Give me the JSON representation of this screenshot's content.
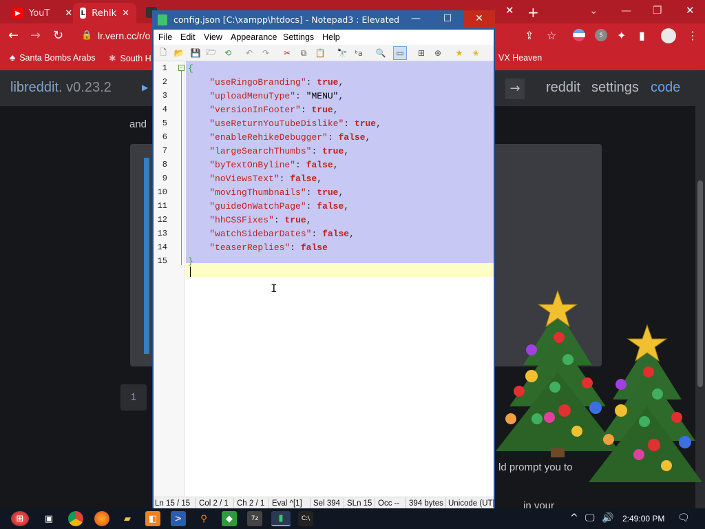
{
  "browser": {
    "tabs": [
      {
        "label": "YouT",
        "icon": "youtube-icon"
      },
      {
        "label": "Rehik",
        "icon": "libreddit-icon",
        "active": true
      }
    ],
    "address": "lr.vern.cc/r/o",
    "bookmarks": [
      "Santa Bombs Arabs",
      "South H",
      "VX Heaven"
    ]
  },
  "page": {
    "brand_lib": "lib",
    "brand_reddit": "reddit.",
    "version": "v0.23.2",
    "nav": {
      "reddit": "reddit",
      "settings": "settings",
      "code": "code"
    },
    "and_text": "and",
    "page_number": "1",
    "prompt_text": "ld prompt you to",
    "bottom_text": "in your"
  },
  "notepad": {
    "title": "config.json [C:\\xampp\\htdocs] - Notepad3 : Elevated",
    "menu": [
      "File",
      "Edit",
      "View",
      "Appearance",
      "Settings",
      "Help"
    ],
    "lines": [
      "{",
      "    \"useRingoBranding\": true,",
      "    \"uploadMenuType\": \"MENU\",",
      "    \"versionInFooter\": true,",
      "    \"useReturnYouTubeDislike\": true,",
      "    \"enableRehikeDebugger\": false,",
      "    \"largeSearchThumbs\": true,",
      "    \"byTextOnByline\": false,",
      "    \"noViewsText\": false,",
      "    \"movingThumbnails\": true,",
      "    \"guideOnWatchPage\": false,",
      "    \"hhCSSFixes\": true,",
      "    \"watchSidebarDates\": false,",
      "    \"teaserReplies\": false",
      "}"
    ],
    "line_numbers": [
      "1",
      "2",
      "3",
      "4",
      "5",
      "6",
      "7",
      "8",
      "9",
      "10",
      "11",
      "12",
      "13",
      "14",
      "15"
    ],
    "status": {
      "ln": "Ln  15 / 15",
      "col": "Col  2 / 1",
      "ch": "Ch  2 / 1",
      "eval": "Eval  ^[1]",
      "sel": "Sel  394",
      "sln": "SLn  15",
      "occ": "Occ  --",
      "bytes": "394 bytes",
      "encoding": "Unicode (UT|"
    }
  },
  "taskbar": {
    "clock": "2:49:00 PM"
  },
  "colors": {
    "browser_red": "#c8232c",
    "selection": "#c7c9f4",
    "current_line": "#fdfdc7",
    "json_key": "#c2201e"
  }
}
